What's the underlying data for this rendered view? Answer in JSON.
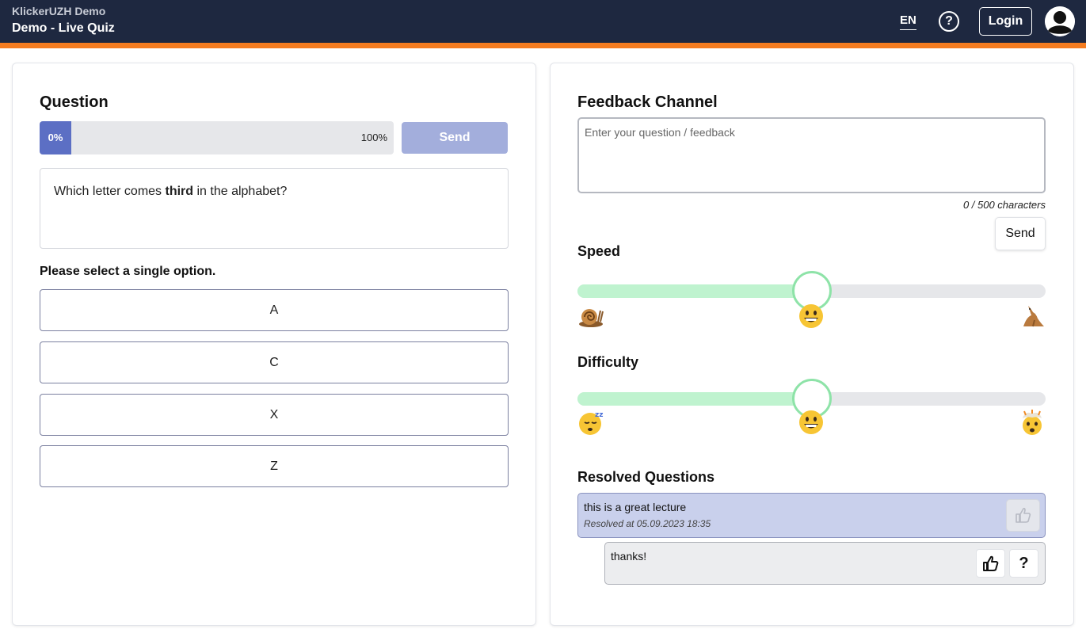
{
  "header": {
    "app_name": "KlickerUZH Demo",
    "page_title": "Demo - Live Quiz",
    "language": "EN",
    "help_icon": "question-circle-icon",
    "login_label": "Login",
    "avatar_icon": "user-avatar-icon",
    "colors": {
      "background": "#1e2840",
      "accent_strip": "#f47c20"
    }
  },
  "question_panel": {
    "title": "Question",
    "progress": {
      "value_percent": 0,
      "label": "0%",
      "max_label": "100%"
    },
    "send_label": "Send",
    "question_before": "Which letter comes ",
    "question_bold": "third",
    "question_after": " in the alphabet?",
    "instruction": "Please select a single option.",
    "options": [
      "A",
      "C",
      "X",
      "Z"
    ]
  },
  "feedback_panel": {
    "title": "Feedback Channel",
    "input_placeholder": "Enter your question / feedback",
    "input_value": "",
    "char_count": "0 / 500 characters",
    "send_label": "Send",
    "speed": {
      "label": "Speed",
      "value_fraction": 0.5,
      "icons": [
        "snail-icon",
        "grinning-face-icon",
        "kangaroo-icon"
      ]
    },
    "difficulty": {
      "label": "Difficulty",
      "value_fraction": 0.5,
      "icons": [
        "sleeping-face-icon",
        "grinning-face-icon",
        "exploding-head-icon"
      ]
    },
    "resolved_title": "Resolved Questions",
    "resolved_items": [
      {
        "text": "this is a great lecture",
        "meta": "Resolved at 05.09.2023 18:35",
        "upvote_icon": "thumbs-up-icon",
        "reply": {
          "text": "thanks!",
          "upvote_icon": "thumbs-up-icon",
          "question_label": "?"
        }
      }
    ]
  }
}
